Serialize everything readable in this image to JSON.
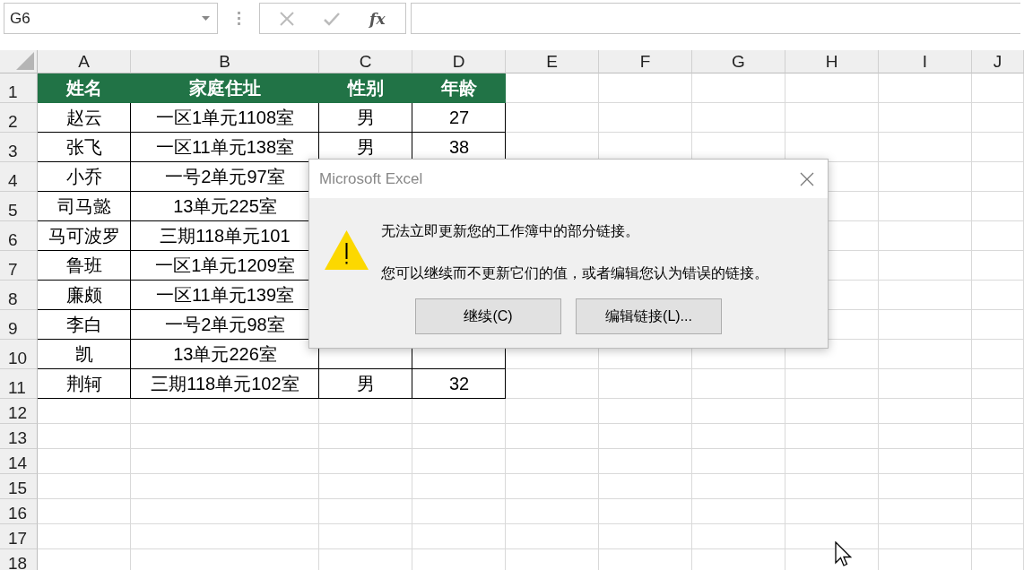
{
  "formula_bar": {
    "name_box": "G6",
    "function_label": "fx"
  },
  "sheet": {
    "columns": [
      "A",
      "B",
      "C",
      "D",
      "E",
      "F",
      "G",
      "H",
      "I",
      "J"
    ],
    "rows": [
      {
        "number": "1",
        "kind": "header",
        "cells": [
          "姓名",
          "家庭住址",
          "性别",
          "年龄"
        ]
      },
      {
        "number": "2",
        "kind": "data",
        "cells": [
          "赵云",
          "一区1单元1108室",
          "男",
          "27"
        ]
      },
      {
        "number": "3",
        "kind": "data",
        "cells": [
          "张飞",
          "一区11单元138室",
          "男",
          "38"
        ]
      },
      {
        "number": "4",
        "kind": "data",
        "cells": [
          "小乔",
          "一号2单元97室",
          null,
          null
        ]
      },
      {
        "number": "5",
        "kind": "data",
        "cells": [
          "司马懿",
          "13单元225室",
          null,
          null
        ]
      },
      {
        "number": "6",
        "kind": "data",
        "cells": [
          "马可波罗",
          "三期118单元101",
          null,
          null
        ]
      },
      {
        "number": "7",
        "kind": "data",
        "cells": [
          "鲁班",
          "一区1单元1209室",
          null,
          null
        ]
      },
      {
        "number": "8",
        "kind": "data",
        "cells": [
          "廉颇",
          "一区11单元139室",
          null,
          null
        ]
      },
      {
        "number": "9",
        "kind": "data",
        "cells": [
          "李白",
          "一号2单元98室",
          null,
          null
        ]
      },
      {
        "number": "10",
        "kind": "data",
        "cells": [
          "凯",
          "13单元226室"
        ]
      },
      {
        "number": "11",
        "kind": "data",
        "cells": [
          "荆轲",
          "三期118单元102室",
          "男",
          "32"
        ]
      },
      {
        "number": "12",
        "kind": "empty",
        "cells": []
      },
      {
        "number": "13",
        "kind": "empty",
        "cells": []
      },
      {
        "number": "14",
        "kind": "empty",
        "cells": []
      },
      {
        "number": "15",
        "kind": "empty",
        "cells": []
      },
      {
        "number": "16",
        "kind": "empty",
        "cells": []
      },
      {
        "number": "17",
        "kind": "empty",
        "cells": []
      },
      {
        "number": "18",
        "kind": "empty",
        "cells": []
      }
    ]
  },
  "dialog": {
    "title": "Microsoft Excel",
    "messages": [
      "无法立即更新您的工作簿中的部分链接。",
      "您可以继续而不更新它们的值，或者编辑您认为错误的链接。"
    ],
    "buttons": [
      "继续(C)",
      "编辑链接(L)..."
    ]
  }
}
